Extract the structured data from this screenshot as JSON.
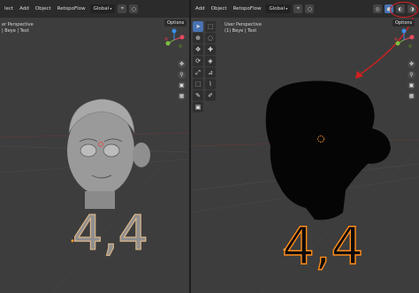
{
  "left_header": {
    "menus": [
      "lect",
      "Add",
      "Object",
      "RetopoFlow"
    ],
    "transform_dropdown": "Global",
    "options_label": "Options"
  },
  "right_header": {
    "menus": [
      "Add",
      "Object",
      "RetopoFlow"
    ],
    "transform_dropdown": "Global",
    "options_label": "Options"
  },
  "left_overlay": {
    "perspective": "er Perspective",
    "collection": "| Beye | Text"
  },
  "right_overlay": {
    "perspective": "User Perspective",
    "collection": "(1) Beye | Text"
  },
  "left_text_object": "4,4",
  "right_text_object": "4,4",
  "colors": {
    "header_bg": "#2b2b2b",
    "viewport_bg": "#3d3d3d",
    "tool_active": "#4772b3",
    "annotation_red": "#d32020",
    "text_outline_orange": "#ff8c1a",
    "axis_x": "#e84a5f",
    "axis_y": "#7fbf3f",
    "axis_z": "#3a8ee6"
  },
  "icons": [
    "move-view-icon",
    "zoom-icon",
    "camera-icon",
    "grid-icon",
    "cursor-icon",
    "select-icon",
    "move-icon",
    "rotate-icon",
    "scale-icon",
    "transform-icon",
    "annotate-icon",
    "measure-icon"
  ]
}
